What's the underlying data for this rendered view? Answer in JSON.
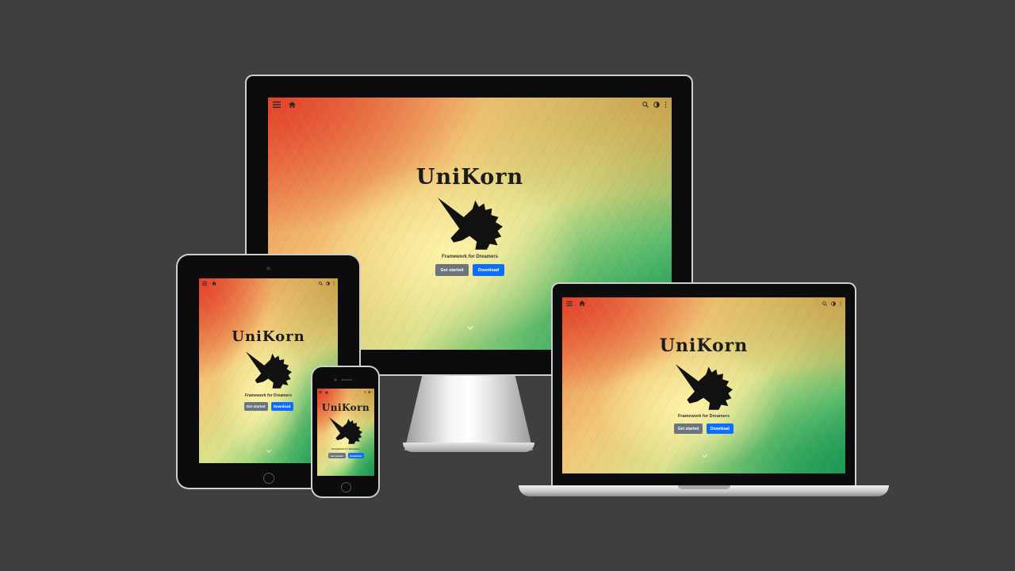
{
  "site": {
    "title": "UniKorn",
    "tagline": "Framework for Dreamers",
    "primary_button": "Get started",
    "secondary_button": "Download"
  },
  "icons": {
    "menu": "hamburger-menu-icon",
    "home": "home-icon",
    "search": "search-icon",
    "theme": "contrast-icon",
    "more": "more-vertical-icon",
    "scroll": "chevron-down-icon",
    "logo": "unicorn-head-logo"
  },
  "colors": {
    "page_background": "#3f3f3f",
    "button_secondary": "#6c757d",
    "button_primary": "#0d6efd",
    "title_text": "#1c1c1c"
  },
  "devices": [
    "desktop-monitor",
    "tablet",
    "phone",
    "laptop"
  ]
}
